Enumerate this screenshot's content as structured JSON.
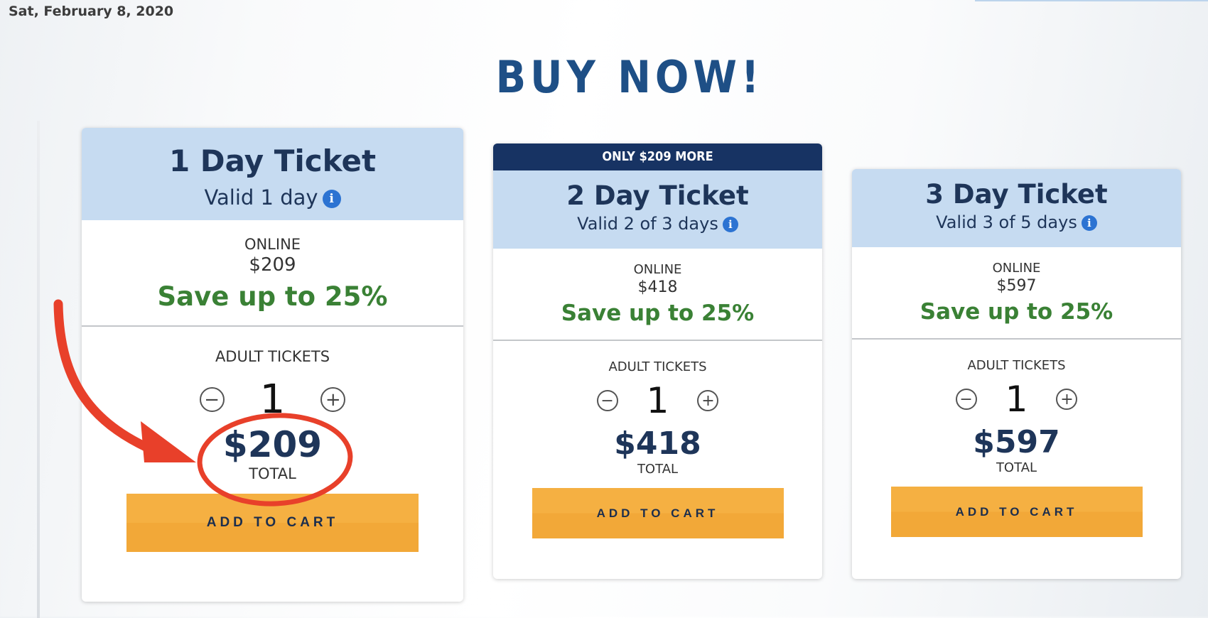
{
  "date": "Sat, February 8, 2020",
  "headline": "BUY NOW!",
  "info_glyph": "i",
  "stepper": {
    "minus": "−",
    "plus": "+"
  },
  "colors": {
    "header_bg": "#c6dbf1",
    "navy": "#1e3559",
    "headline": "#1e4f86",
    "save_green": "#3a8135",
    "button_orange": "#f5b042",
    "badge_bg": "#173363",
    "info_blue": "#2c73d2",
    "annotation_red": "#e8402a"
  },
  "icons": {
    "info": "info-icon",
    "minus": "minus-circle-icon",
    "plus": "plus-circle-icon"
  },
  "cards": [
    {
      "title": "1 Day Ticket",
      "valid": "Valid 1 day",
      "online_label": "ONLINE",
      "online_price": "$209",
      "save": "Save up to 25%",
      "adult_label": "ADULT TICKETS",
      "quantity": "1",
      "total": "$209",
      "total_label": "TOTAL",
      "button": "ADD TO CART"
    },
    {
      "badge": "ONLY $209 MORE",
      "title": "2 Day Ticket",
      "valid": "Valid 2 of 3 days",
      "online_label": "ONLINE",
      "online_price": "$418",
      "save": "Save up to 25%",
      "adult_label": "ADULT TICKETS",
      "quantity": "1",
      "total": "$418",
      "total_label": "TOTAL",
      "button": "ADD TO CART"
    },
    {
      "title": "3 Day Ticket",
      "valid": "Valid 3 of 5 days",
      "online_label": "ONLINE",
      "online_price": "$597",
      "save": "Save up to 25%",
      "adult_label": "ADULT TICKETS",
      "quantity": "1",
      "total": "$597",
      "total_label": "TOTAL",
      "button": "ADD TO CART"
    }
  ]
}
